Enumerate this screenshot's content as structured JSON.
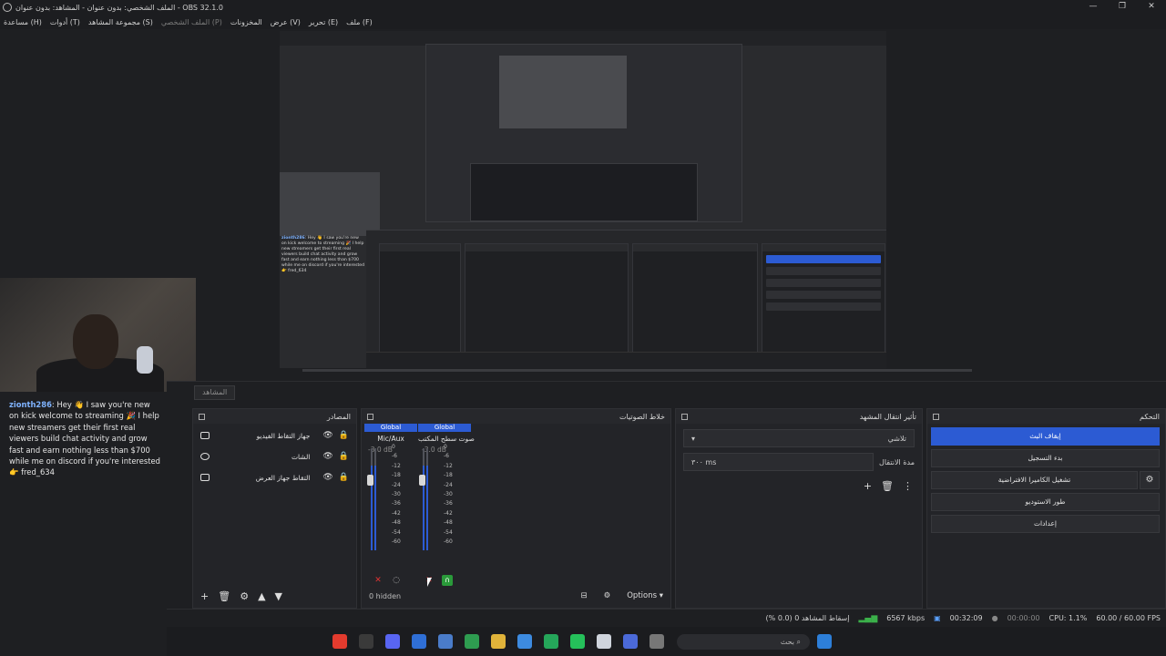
{
  "window": {
    "title": "OBS 32.1.0 - الملف الشخصي: بدون عنوان - المشاهد: بدون عنوان",
    "controls": [
      "—",
      "❐",
      "✕"
    ]
  },
  "menu": [
    {
      "label": "ملف (F)",
      "dim": false
    },
    {
      "label": "تحرير (E)",
      "dim": false
    },
    {
      "label": "عرض (V)",
      "dim": false
    },
    {
      "label": "المخزونات",
      "dim": false
    },
    {
      "label": "الملف الشخصي (P)",
      "dim": true
    },
    {
      "label": "مجموعة المشاهد (S)",
      "dim": false
    },
    {
      "label": "أدوات (T)",
      "dim": false
    },
    {
      "label": "مساعدة (H)",
      "dim": false
    }
  ],
  "chat": {
    "user": "zionth286",
    "message": ": Hey 👋 I saw you're new on kick welcome to streaming 🎉 I help new streamers get their first real viewers build chat activity and grow fast and earn nothing less than $700 while me on discord if you're interested 👉 fred_634"
  },
  "scenes_tab": {
    "label": "المشاهد"
  },
  "sources": {
    "title": "المصادر",
    "items": [
      {
        "label": "جهاز التقاط الفيديو",
        "icon": "camera-icon"
      },
      {
        "label": "الشات",
        "icon": "globe-icon"
      },
      {
        "label": "التقاط جهاز العرض",
        "icon": "monitor-icon"
      }
    ],
    "footer_icons": [
      "+",
      "🗑",
      "⚙",
      "▲",
      "▼"
    ]
  },
  "mixer": {
    "title": "خلاط الصوتيات",
    "channels": [
      {
        "global": "Global",
        "name": "Mic/Aux",
        "db": "-3.0 dB",
        "level": 0.83
      },
      {
        "global": "Global",
        "name": "صوت سطح المكتب",
        "db": "-3.0 dB",
        "level": 0.83
      }
    ],
    "scale": [
      "0",
      "-6",
      "-12",
      "-18",
      "-24",
      "-30",
      "-36",
      "-42",
      "-48",
      "-54",
      "-60"
    ],
    "hidden_label": "0 hidden",
    "options_label": "Options"
  },
  "transitions": {
    "title": "تأثير انتقال المشهد",
    "selected": "تلاشي",
    "duration_label": "مدة الانتقال",
    "duration_value": "٣٠٠ ms"
  },
  "controls": {
    "title": "التحكم",
    "stop_stream": "إيقاف البث",
    "start_record": "بدء التسجيل",
    "virtual_cam": "تشغيل الكاميرا الافتراضية",
    "studio_mode": "طور الاستوديو",
    "settings": "إعدادات"
  },
  "status": {
    "dropped": "إسقاط المشاهد 0 (0.0 %)",
    "bitrate": "6567 kbps",
    "live_time": "00:32:09",
    "rec_time": "00:00:00",
    "cpu": "CPU: 1.1%",
    "fps": "60.00 / 60.00 FPS"
  },
  "taskbar": {
    "search_placeholder": "بحث",
    "apps": [
      {
        "name": "youtube-icon",
        "color": "#e33b2e"
      },
      {
        "name": "obs-icon",
        "color": "#3a3a3a"
      },
      {
        "name": "discord-icon",
        "color": "#5865f2"
      },
      {
        "name": "mail-icon",
        "color": "#2f6fd6"
      },
      {
        "name": "store-icon",
        "color": "#4a7cc9"
      },
      {
        "name": "chrome-icon",
        "color": "#2e9c50"
      },
      {
        "name": "folder-icon",
        "color": "#e0b33a"
      },
      {
        "name": "copilot-icon",
        "color": "#3d8be0"
      },
      {
        "name": "whatsapp-web-icon",
        "color": "#25a65a"
      },
      {
        "name": "whatsapp-icon",
        "color": "#25c05a"
      },
      {
        "name": "steam-icon",
        "color": "#cfd4dc"
      },
      {
        "name": "app-icon",
        "color": "#4b6ad9"
      },
      {
        "name": "window-icon",
        "color": "#777"
      }
    ]
  }
}
